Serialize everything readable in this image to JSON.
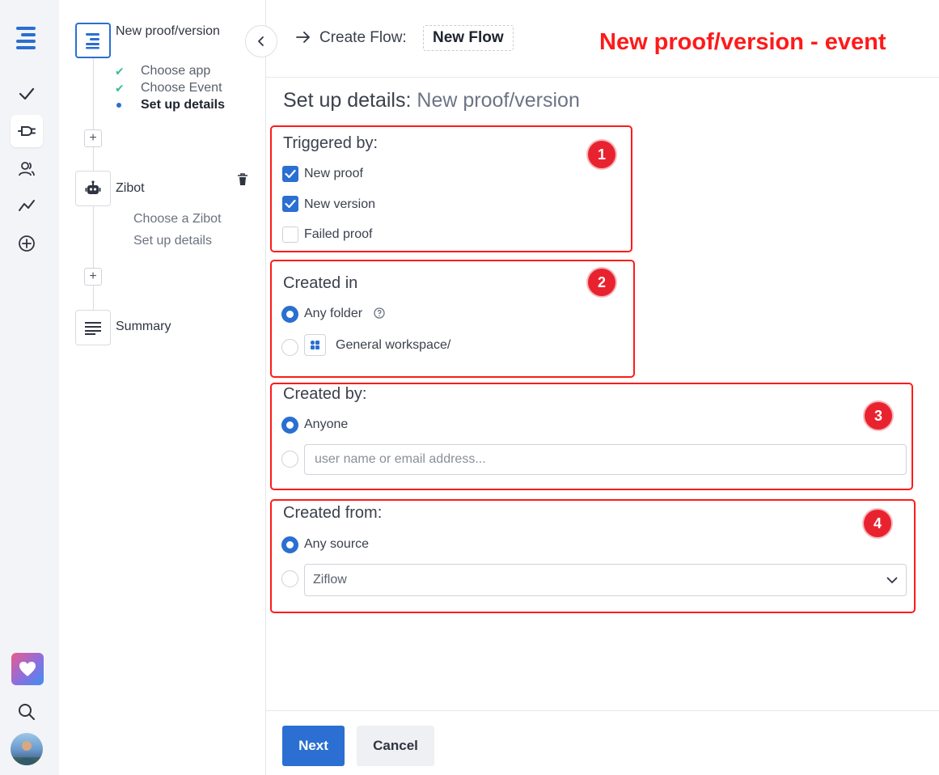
{
  "sidebar": {
    "icons": [
      "logo-icon",
      "check-icon",
      "plug-icon",
      "users-icon",
      "analytics-icon",
      "add-circle-icon",
      "heart-icon",
      "search-icon",
      "avatar"
    ]
  },
  "steps": {
    "trigger": {
      "title": "New proof/version",
      "items": [
        {
          "label": "Choose app",
          "state": "done"
        },
        {
          "label": "Choose Event",
          "state": "done"
        },
        {
          "label": "Set up details",
          "state": "current"
        }
      ]
    },
    "action": {
      "title": "Zibot",
      "items": [
        {
          "label": "Choose a Zibot"
        },
        {
          "label": "Set up details"
        }
      ]
    },
    "summary": {
      "title": "Summary"
    }
  },
  "header": {
    "prefix": "Create Flow:",
    "flow_name": "New Flow",
    "annotation": "New proof/version - event"
  },
  "main": {
    "title_prefix": "Set up details:",
    "title_muted": "New proof/version",
    "triggered_by": {
      "label": "Triggered by:",
      "options": [
        {
          "label": "New proof",
          "checked": true
        },
        {
          "label": "New version",
          "checked": true
        },
        {
          "label": "Failed proof",
          "checked": false
        }
      ]
    },
    "created_in": {
      "label": "Created in",
      "any_folder": "Any folder",
      "workspace": "General workspace/"
    },
    "created_by": {
      "label": "Created by:",
      "anyone": "Anyone",
      "placeholder": "user name or email address..."
    },
    "created_from": {
      "label": "Created from:",
      "any_source": "Any source",
      "source_value": "Ziflow"
    }
  },
  "annotations": {
    "badges": [
      "1",
      "2",
      "3",
      "4"
    ]
  },
  "colors": {
    "primary": "#2a6fd1",
    "annotation_red": "#ff1a1a",
    "done_green": "#35c28a"
  },
  "footer": {
    "next_label": "Next",
    "cancel_label": "Cancel"
  }
}
